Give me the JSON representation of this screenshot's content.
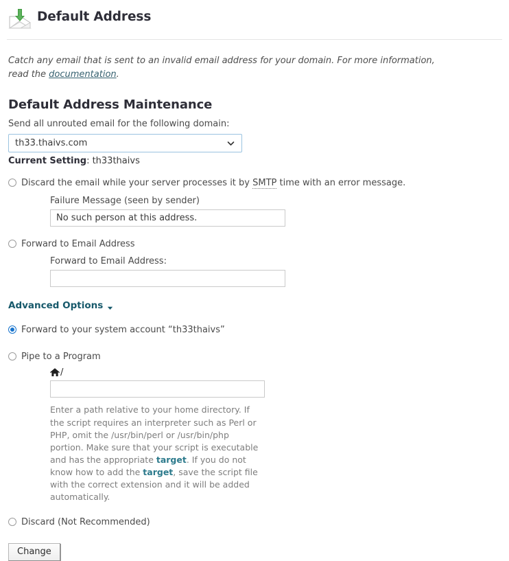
{
  "header": {
    "title": "Default Address",
    "icon": "incoming-mail-icon"
  },
  "intro": {
    "text_before": "Catch any email that is sent to an invalid email address for your domain. For more information, read the ",
    "link_text": "documentation",
    "text_after": "."
  },
  "section": {
    "title": "Default Address Maintenance",
    "domain_label": "Send all unrouted email for the following domain:",
    "domain_select": {
      "value": "th33.thaivs.com",
      "icon": "chevron-down-icon",
      "options": [
        "th33.thaivs.com"
      ]
    },
    "current_setting_label": "Current Setting",
    "current_setting_value": "th33thaivs"
  },
  "options": {
    "discard_smtp": {
      "label_before": "Discard the email while your server processes it by ",
      "abbr": "SMTP",
      "label_after": " time with an error message.",
      "checked": false,
      "failure_label": "Failure Message (seen by sender)",
      "failure_value": "No such person at this address.",
      "failure_placeholder": ""
    },
    "forward_email": {
      "label": "Forward to Email Address",
      "checked": false,
      "sub_label": "Forward to Email Address:",
      "value": "",
      "placeholder": ""
    },
    "advanced_options": {
      "label": "Advanced Options",
      "icon": "caret-down-icon"
    },
    "forward_system": {
      "label": "Forward to your system account “th33thaivs”",
      "checked": true
    },
    "pipe_program": {
      "label": "Pipe to a Program",
      "checked": false,
      "home_icon": "home-icon",
      "path_prefix": "/",
      "value": "",
      "placeholder": "",
      "help_1": "Enter a path relative to your home directory. If the script requires an interpreter such as Perl or PHP, omit the /usr/bin/perl or /usr/bin/php portion. Make sure that your script is executable and has the appropriate ",
      "help_target_1": "target",
      "help_2": ". If you do not know how to add the ",
      "help_target_2": "target",
      "help_3": ", save the script file with the correct extension and it will be added automatically."
    },
    "discard": {
      "label": "Discard (Not Recommended)",
      "checked": false
    }
  },
  "footer": {
    "submit_label": "Change"
  },
  "colors": {
    "link_teal": "#17596b",
    "radio_blue": "#1874cd",
    "select_border": "#9ac3e0",
    "heading": "#2e2e38",
    "help_text": "#7d7d7d"
  }
}
